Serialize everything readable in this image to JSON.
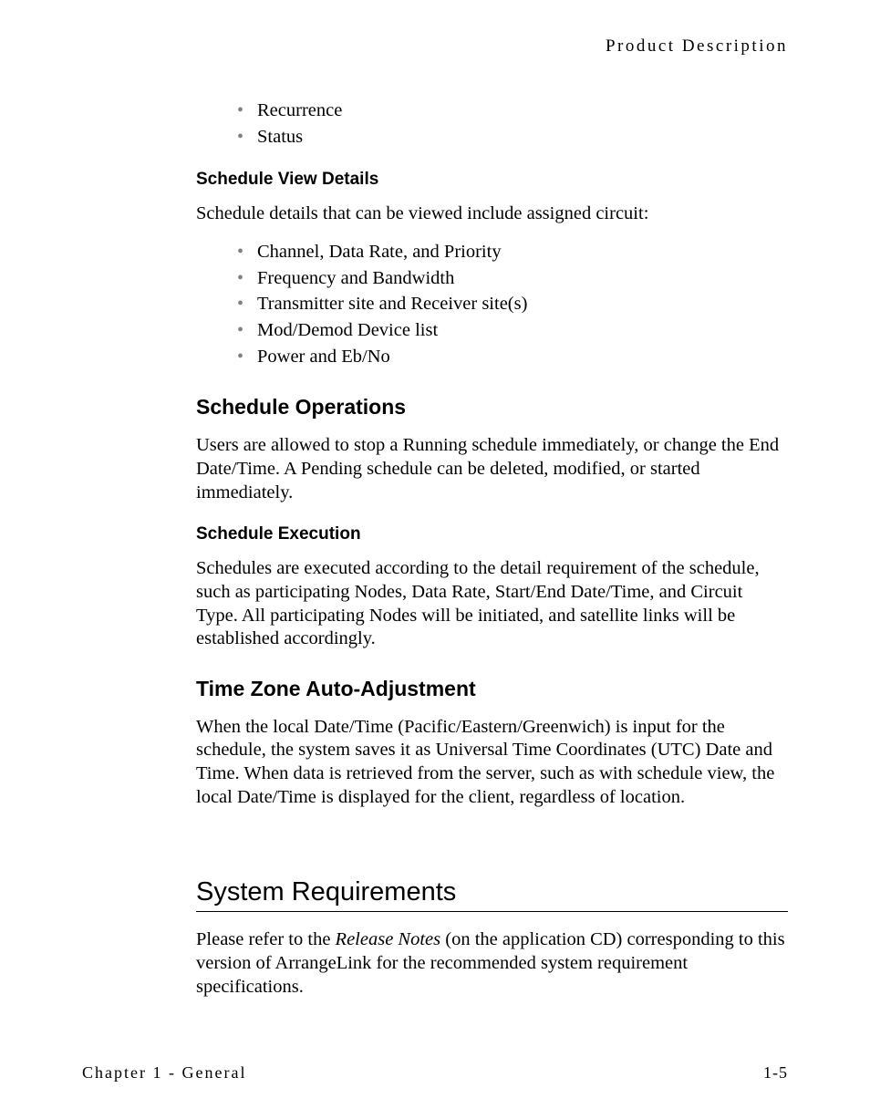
{
  "header": {
    "label": "Product Description"
  },
  "top_list": {
    "items": [
      "Recurrence",
      "Status"
    ]
  },
  "schedule_view_details": {
    "title": "Schedule View Details",
    "intro": "Schedule details that can be viewed include assigned circuit:",
    "items": [
      "Channel, Data Rate, and Priority",
      "Frequency and Bandwidth",
      "Transmitter site and Receiver site(s)",
      "Mod/Demod Device list",
      "Power and Eb/No"
    ]
  },
  "schedule_operations": {
    "title": "Schedule Operations",
    "body": "Users are allowed to stop a Running schedule immediately, or change the End Date/Time. A Pending schedule can be deleted, modified, or started immediately."
  },
  "schedule_execution": {
    "title": "Schedule Execution",
    "body": "Schedules are executed according to the detail requirement of the schedule, such as participating Nodes, Data Rate, Start/End Date/Time, and Circuit Type. All participating Nodes will be initiated, and satellite links will be established accordingly."
  },
  "time_zone": {
    "title": "Time Zone Auto-Adjustment",
    "body": "When the local Date/Time (Pacific/Eastern/Greenwich) is input for the schedule, the system saves it as Universal Time Coordinates (UTC) Date and Time. When data is retrieved from the server, such as with schedule view, the local Date/Time is displayed for the client, regardless of location."
  },
  "system_requirements": {
    "title": "System Requirements",
    "body_prefix": "Please refer to the ",
    "body_italic": "Release Notes",
    "body_suffix": " (on the application CD) corresponding to this version of ArrangeLink for the recommended system requirement specifications."
  },
  "footer": {
    "left_prefix": "Chapter ",
    "left_number": "1",
    "left_suffix": " - General",
    "right": "1-5"
  }
}
